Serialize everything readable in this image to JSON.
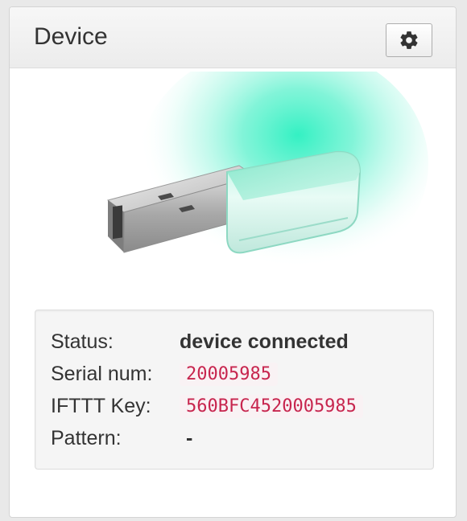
{
  "panel": {
    "title": "Device",
    "settings_icon": "gear-icon"
  },
  "device": {
    "image": "usb-light-device",
    "glow_color": "#2fe6b4"
  },
  "info": {
    "status_label": "Status:",
    "status_value": "device connected",
    "serial_label": "Serial num:",
    "serial_value": "20005985",
    "ifttt_label": "IFTTT Key:",
    "ifttt_value": "560BFC4520005985",
    "pattern_label": "Pattern:",
    "pattern_value": "-"
  },
  "colors": {
    "code_text": "#c7254e",
    "code_bg": "#f9f2f4"
  }
}
